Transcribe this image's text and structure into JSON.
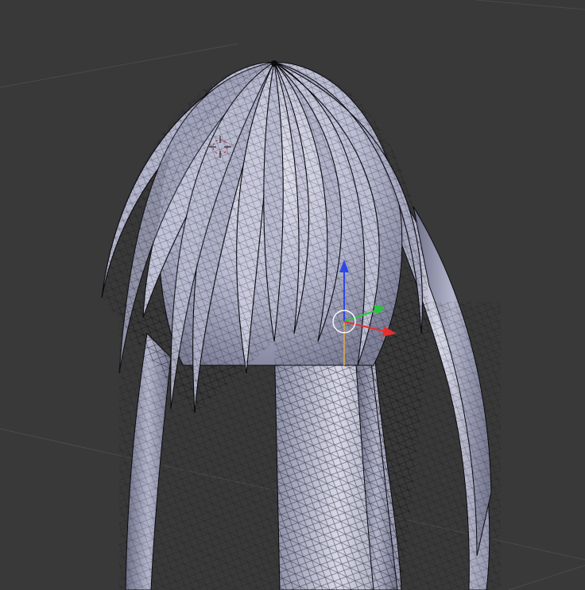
{
  "viewport": {
    "background_color": "#393939",
    "grid_line_color": "#4a4a4a",
    "mesh_face_color": "#a9aac4",
    "mesh_highlight_color": "#d8d9ea",
    "mesh_wire_color": "#0b0b10",
    "cursor_3d_color": "#c23a3a"
  },
  "gizmo": {
    "x_axis_color": "#e53030",
    "y_axis_color": "#27c63a",
    "z_axis_color": "#2e46e8",
    "center_ring_color": "#ffffff",
    "origin_line_color": "#c9a15a"
  },
  "icons": {
    "cursor": "3d-cursor-icon",
    "gizmo": "transform-gizmo-icon"
  }
}
